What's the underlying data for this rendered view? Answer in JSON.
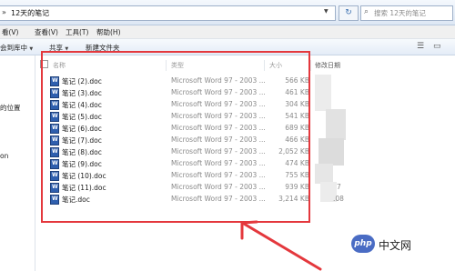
{
  "address": {
    "path": "12天的笔记",
    "search_placeholder": "搜索 12天的笔记"
  },
  "menu": [
    "看(V)",
    "查看(V)",
    "工具(T)",
    "帮助(H)"
  ],
  "toolbar": {
    "include_library": "会到库中",
    "share": "共享",
    "new_folder": "新建文件夹"
  },
  "nav": {
    "item1": "的位置",
    "item2": "on"
  },
  "columns": {
    "name": "名称",
    "type": "类型",
    "size": "大小",
    "date": "修改日期"
  },
  "files": [
    {
      "name": "笔记 (2).doc",
      "type": "Microsoft Word 97 - 2003 ...",
      "size": "566 KB"
    },
    {
      "name": "笔记 (3).doc",
      "type": "Microsoft Word 97 - 2003 ...",
      "size": "461 KB"
    },
    {
      "name": "笔记 (4).doc",
      "type": "Microsoft Word 97 - 2003 ...",
      "size": "304 KB"
    },
    {
      "name": "笔记 (5).doc",
      "type": "Microsoft Word 97 - 2003 ...",
      "size": "541 KB"
    },
    {
      "name": "笔记 (6).doc",
      "type": "Microsoft Word 97 - 2003 ...",
      "size": "689 KB"
    },
    {
      "name": "笔记 (7).doc",
      "type": "Microsoft Word 97 - 2003 ...",
      "size": "466 KB"
    },
    {
      "name": "笔记 (8).doc",
      "type": "Microsoft Word 97 - 2003 ...",
      "size": "2,052 KB"
    },
    {
      "name": "笔记 (9).doc",
      "type": "Microsoft Word 97 - 2003 ...",
      "size": "474 KB"
    },
    {
      "name": "笔记 (10).doc",
      "type": "Microsoft Word 97 - 2003 ...",
      "size": "755 KB"
    },
    {
      "name": "笔记 (11).doc",
      "type": "Microsoft Word 97 - 2003 ...",
      "size": "939 KB"
    },
    {
      "name": "笔记.doc",
      "type": "Microsoft Word 97 - 2003 ...",
      "size": "3,214 KB"
    }
  ],
  "date_fragments": [
    "7",
    ".08"
  ],
  "watermark": {
    "logo": "php",
    "text": "中文网"
  },
  "colors": {
    "annotation": "#e4383d",
    "doc_icon": "#2f5fae"
  }
}
